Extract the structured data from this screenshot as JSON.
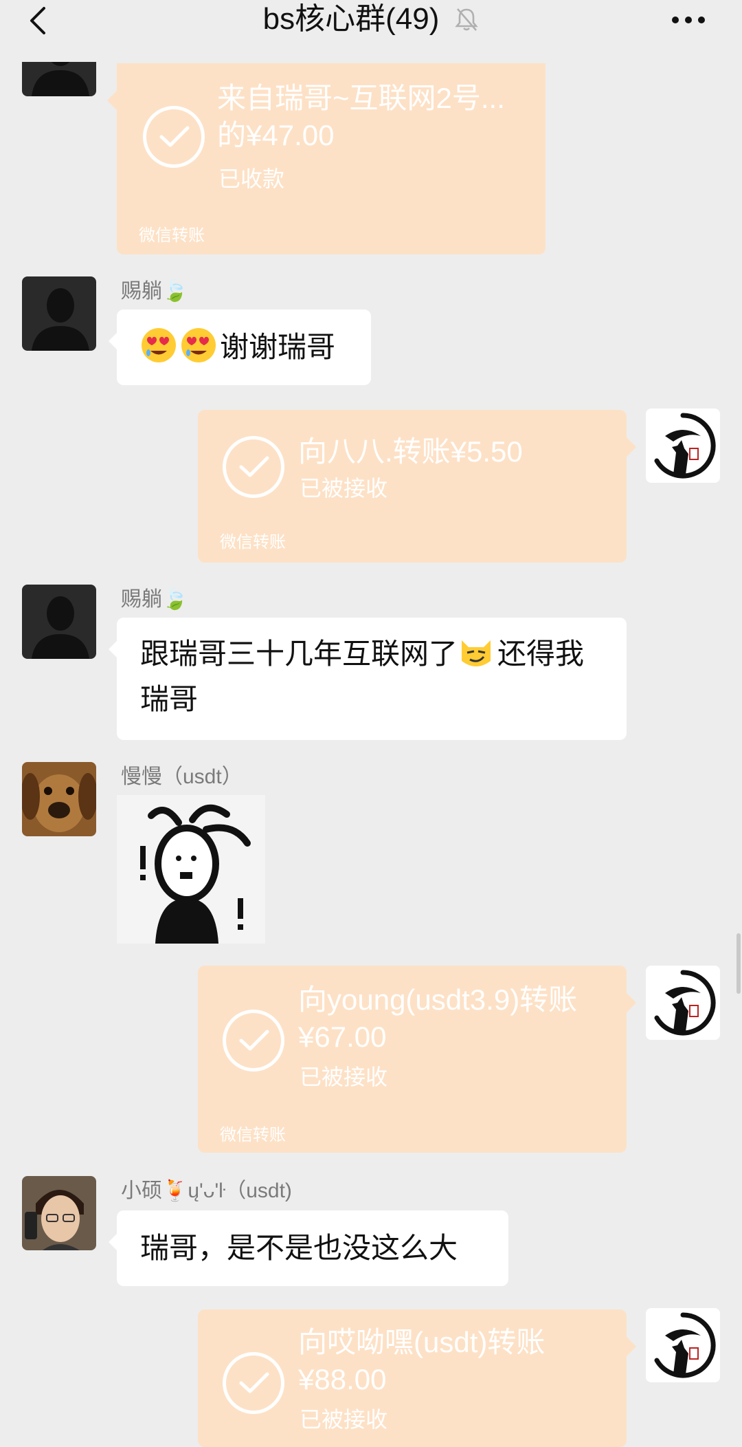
{
  "header": {
    "title": "bs核心群(49)",
    "back_icon": "chevron-left-icon",
    "mute_icon": "bell-muted-icon",
    "more_icon": "more-dots-icon"
  },
  "messages": {
    "m1": {
      "line1": "来自瑞哥~互联网2号...",
      "line2": "的¥47.00",
      "status": "已收款",
      "footer": "微信转账"
    },
    "m2": {
      "sender": "赐躺🍃",
      "text": "谢谢瑞哥",
      "emoji": "heart-eyes-emoji"
    },
    "m3": {
      "line1": "向八八.转账¥5.50",
      "status": "已被接收",
      "footer": "微信转账"
    },
    "m4": {
      "sender": "赐躺🍃",
      "text_before": "跟瑞哥三十几年互联网了",
      "text_after": "还得我瑞哥",
      "emoji": "smirking-cat-emoji"
    },
    "m5": {
      "sender": "慢慢（usdt）",
      "sticker": "exclaiming-stick-figure-sticker"
    },
    "m6": {
      "line1": "向young(usdt3.9)转账",
      "line2": "¥67.00",
      "status": "已被接收",
      "footer": "微信转账"
    },
    "m7": {
      "sender": "小硕🍹ų'ᴗ'ŀ（usdt)",
      "text": "瑞哥，是不是也没这么大"
    },
    "m8": {
      "line1": "向哎呦嘿(usdt)转账",
      "line2": "¥88.00",
      "status": "已被接收"
    }
  },
  "colors": {
    "background": "#ededed",
    "transfer_card": "#fde1c6",
    "bubble": "#ffffff",
    "sender_name": "#7a7a7a"
  }
}
